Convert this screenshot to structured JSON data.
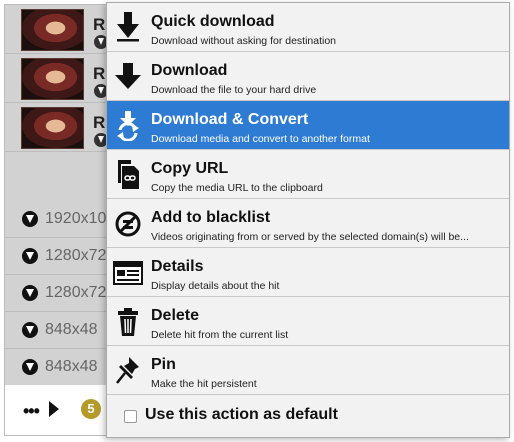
{
  "list": {
    "media_items": [
      {
        "title_fragment": "R"
      },
      {
        "title_fragment": "R"
      },
      {
        "title_fragment": "R"
      }
    ],
    "resolutions": [
      "1920x10",
      "1280x72",
      "1280x72",
      "848x48",
      "848x48"
    ],
    "more_label": "•••",
    "count_badge": "5"
  },
  "menu": {
    "items": [
      {
        "title": "Quick download",
        "description": "Download without asking for destination",
        "icon": "quick-download-icon"
      },
      {
        "title": "Download",
        "description": "Download the file to your hard drive",
        "icon": "download-icon"
      },
      {
        "title": "Download & Convert",
        "description": "Download media and convert to another format",
        "icon": "download-convert-icon",
        "active": true
      },
      {
        "title": "Copy URL",
        "description": "Copy the media URL to the clipboard",
        "icon": "copy-url-icon"
      },
      {
        "title": "Add to blacklist",
        "description": "Videos originating from or served by the selected domain(s) will be...",
        "icon": "blacklist-icon"
      },
      {
        "title": "Details",
        "description": "Display details about the hit",
        "icon": "details-icon"
      },
      {
        "title": "Delete",
        "description": "Delete hit from the current list",
        "icon": "trash-icon"
      },
      {
        "title": "Pin",
        "description": "Make the hit persistent",
        "icon": "pin-icon"
      }
    ],
    "default_label": "Use this action as default",
    "default_checked": false
  },
  "colors": {
    "highlight": "#2e7bd3",
    "badge": "#b59a2a"
  }
}
